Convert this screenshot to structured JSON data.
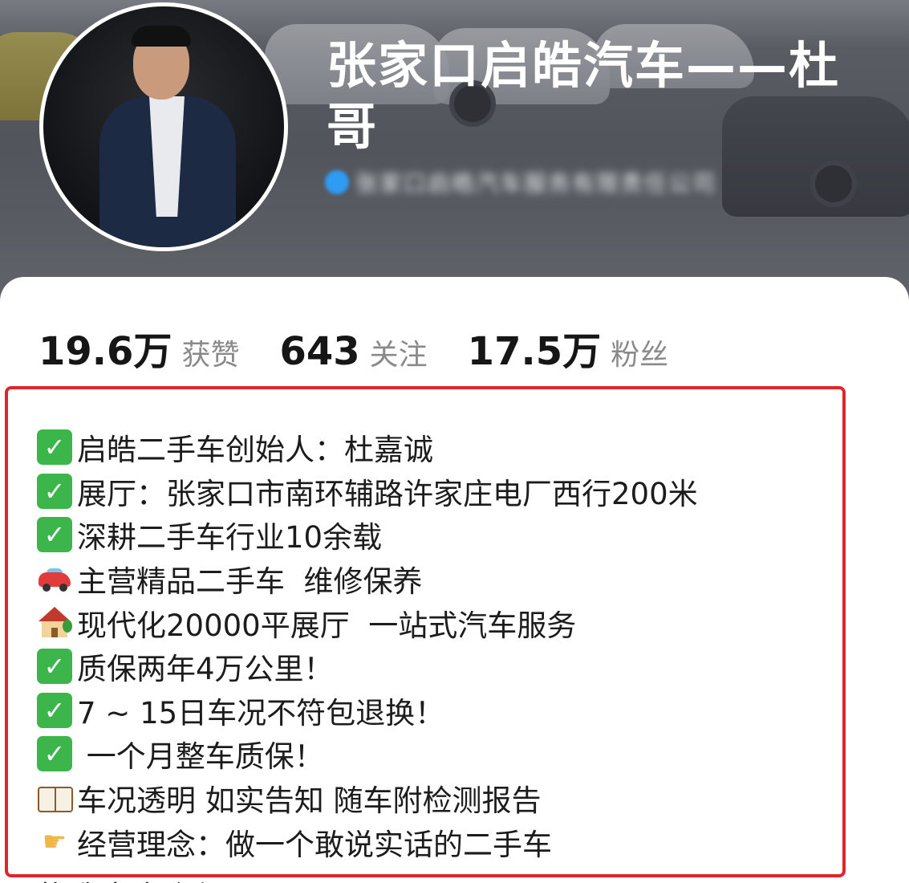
{
  "profile": {
    "name": "张家口启皓汽车——杜哥",
    "verification_text": "张家口启皓汽车服务有限责任公司"
  },
  "stats": [
    {
      "value": "19.6万",
      "label": "获赞"
    },
    {
      "value": "643",
      "label": "关注"
    },
    {
      "value": "17.5万",
      "label": "粉丝"
    }
  ],
  "bio": [
    {
      "icon": "check-icon",
      "text": "启皓二手车创始人：杜嘉诚"
    },
    {
      "icon": "check-icon",
      "text": "展厅：张家口市南环辅路许家庄电厂西行200米"
    },
    {
      "icon": "check-icon",
      "text": "深耕二手车行业10余载"
    },
    {
      "icon": "car-icon",
      "text": "主营精品二手车  维修保养"
    },
    {
      "icon": "house-icon",
      "text": "现代化20000平展厅  一站式汽车服务"
    },
    {
      "icon": "check-icon",
      "text": "质保两年4万公里！"
    },
    {
      "icon": "check-icon",
      "text": "7 ~ 15日车况不符包退换！"
    },
    {
      "icon": "check-icon",
      "text": " 一个月整车质保！"
    },
    {
      "icon": "book-icon",
      "text": "车况透明 如实告知 随车附检测报告"
    },
    {
      "icon": "pointing-hand-icon",
      "text": "经营理念：做一个敢说实话的二手车"
    }
  ],
  "bio_cutoff_text": "找我享官介绍",
  "colors": {
    "highlight_border": "#e0262a",
    "check_green": "#3cb64b",
    "verify_blue": "#2f9bf2"
  }
}
